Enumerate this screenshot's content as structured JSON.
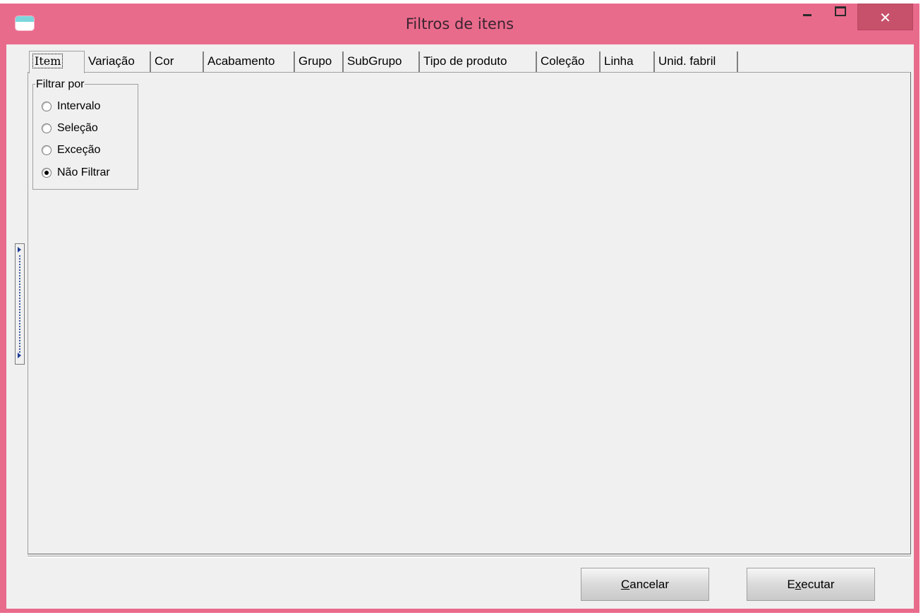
{
  "window": {
    "title": "Filtros de itens",
    "close_glyph": "✕"
  },
  "tabs": [
    {
      "label": "Item",
      "active": true
    },
    {
      "label": "Variação"
    },
    {
      "label": "Cor"
    },
    {
      "label": "Acabamento"
    },
    {
      "label": "Grupo"
    },
    {
      "label": "SubGrupo"
    },
    {
      "label": "Tipo de produto"
    },
    {
      "label": "Coleção"
    },
    {
      "label": "Linha"
    },
    {
      "label": "Unid. fabril"
    }
  ],
  "filter_group": {
    "legend": "Filtrar por",
    "options": [
      {
        "label": "Intervalo",
        "checked": false
      },
      {
        "label": "Seleção",
        "checked": false
      },
      {
        "label": "Exceção",
        "checked": false
      },
      {
        "label": "Não Filtrar",
        "checked": true
      }
    ]
  },
  "buttons": {
    "cancel": {
      "underlined": "C",
      "rest": "ancelar"
    },
    "execute": {
      "prefix": "E",
      "underlined": "x",
      "rest": "ecutar"
    }
  },
  "colors": {
    "titlebar": "#e96b8c",
    "close_button": "#c7506a",
    "client": "#f0f0f0"
  }
}
